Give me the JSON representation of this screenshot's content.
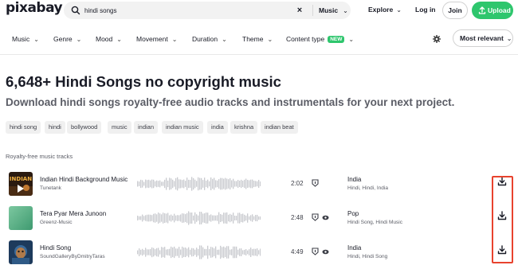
{
  "header": {
    "logo": "pixabay",
    "search": {
      "value": "hindi songs",
      "placeholder": "Search",
      "type": "Music"
    },
    "explore": "Explore",
    "login": "Log in",
    "join": "Join",
    "upload": "Upload",
    "accent_color": "#2ec66d"
  },
  "filters": {
    "items": [
      {
        "label": "Music"
      },
      {
        "label": "Genre"
      },
      {
        "label": "Mood"
      },
      {
        "label": "Movement"
      },
      {
        "label": "Duration"
      },
      {
        "label": "Theme"
      },
      {
        "label": "Content type",
        "badge": "NEW"
      }
    ],
    "sort": "Most relevant"
  },
  "main": {
    "title": "6,648+ Hindi Songs no copyright music",
    "subtitle": "Download hindi songs royalty-free audio tracks and instrumentals for your next project.",
    "tags": [
      "hindi song",
      "hindi",
      "bollywood",
      "music",
      "indian",
      "indian music",
      "india",
      "krishna",
      "indian beat"
    ],
    "section_label": "Royalty-free music tracks",
    "tracks": [
      {
        "title": "Indian Hindi Background Music",
        "author": "Tunetank",
        "duration": "2:02",
        "genre": "India",
        "subgenres": "Hindi, Hindi, India",
        "thumb_icon": "play-icon"
      },
      {
        "title": "Tera Pyar Mera Junoon",
        "author": "Greenz-Music",
        "duration": "2:48",
        "genre": "Pop",
        "subgenres": "Hindi Song, Hindi Music"
      },
      {
        "title": "Hindi Song",
        "author": "SoundGalleryByDmitryTaras",
        "duration": "4:49",
        "genre": "India",
        "subgenres": "Hindi, Hindi Song"
      }
    ]
  },
  "highlight_color": "#e8432e"
}
